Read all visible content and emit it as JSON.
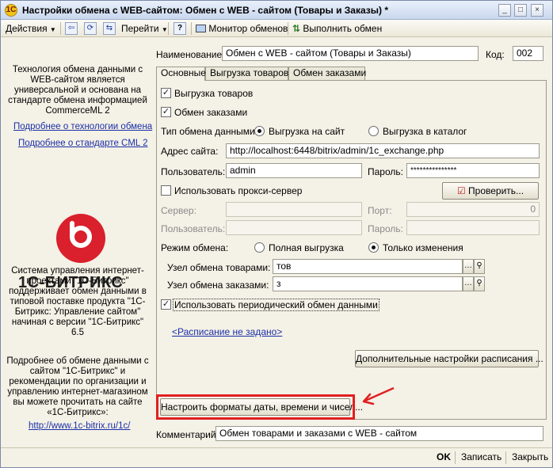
{
  "window": {
    "title": "Настройки обмена с WEB-сайтом: Обмен с WEB - сайтом (Товары и Заказы) *",
    "app_icon": "1С",
    "controls": [
      "_",
      "□",
      "×"
    ]
  },
  "toolbar": {
    "actions_label": "Действия",
    "goto_label": "Перейти",
    "help_label": "?",
    "monitor_label": "Монитор обменов",
    "execute_label": "Выполнить обмен"
  },
  "left": {
    "intro_text": "Технология обмена данными с WEB-сайтом является универсальной и основана на стандарте обмена информацией CommerceML 2",
    "link_tech": "Подробнее о технологии обмена",
    "link_cml": "Подробнее о стандарте CML 2",
    "logo_text": "1С-БИТРИКС",
    "system_text": "Система управления интернет-проектами \"1С-Битрикс\" поддерживает обмен данными в типовой поставке продукта \"1С-Битрикс: Управление сайтом\" начиная с версии \"1С-Битрикс\" 6.5",
    "more_text": "Подробнее об обмене данными с сайтом \"1С-Битрикс\" и рекомендации по организации и управлению интернет-магазином вы можете прочитать на сайте «1С-Битрикс»:",
    "site_link": "http://www.1c-bitrix.ru/1c/"
  },
  "form": {
    "name_label": "Наименование:",
    "name_value": "Обмен с WEB - сайтом (Товары и Заказы)",
    "code_label": "Код:",
    "code_value": "002",
    "tabs": [
      "Основные",
      "Выгрузка товаров",
      "Обмен заказами"
    ],
    "goods_upload_label": "Выгрузка товаров",
    "orders_exchange_label": "Обмен заказами",
    "exchange_type_label": "Тип обмена данными:",
    "type_site_label": "Выгрузка на сайт",
    "type_catalog_label": "Выгрузка в каталог",
    "site_address_label": "Адрес сайта:",
    "site_address_value": "http://localhost:6448/bitrix/admin/1c_exchange.php",
    "user_label": "Пользователь:",
    "user_value": "admin",
    "password_label": "Пароль:",
    "password_value": "***************",
    "proxy_label": "Использовать прокси-сервер",
    "check_button": "Проверить...",
    "server_label": "Сервер:",
    "port_label": "Порт:",
    "port_value": "0",
    "proxy_user_label": "Пользователь:",
    "proxy_password_label": "Пароль:",
    "mode_label": "Режим обмена:",
    "mode_full_label": "Полная выгрузка",
    "mode_changes_label": "Только изменения",
    "goods_node_label": "Узел обмена товарами:",
    "goods_node_value": "тов",
    "orders_node_label": "Узел обмена заказами:",
    "orders_node_value": "з",
    "periodic_label": "Использовать периодический обмен данными",
    "schedule_link": "<Расписание не задано>",
    "extra_schedule_button": "Дополнительные настройки расписания ...",
    "formats_button": "Настроить форматы даты, времени и чисел...",
    "comment_label": "Комментарий:",
    "comment_value": "Обмен товарами и заказами с WEB - сайтом"
  },
  "footer": {
    "ok_label": "OK",
    "save_label": "Записать",
    "close_label": "Закрыть"
  },
  "colors": {
    "accent_red": "#e02020",
    "link_blue": "#1b2fa8",
    "bitrix_red": "#d9202c"
  }
}
